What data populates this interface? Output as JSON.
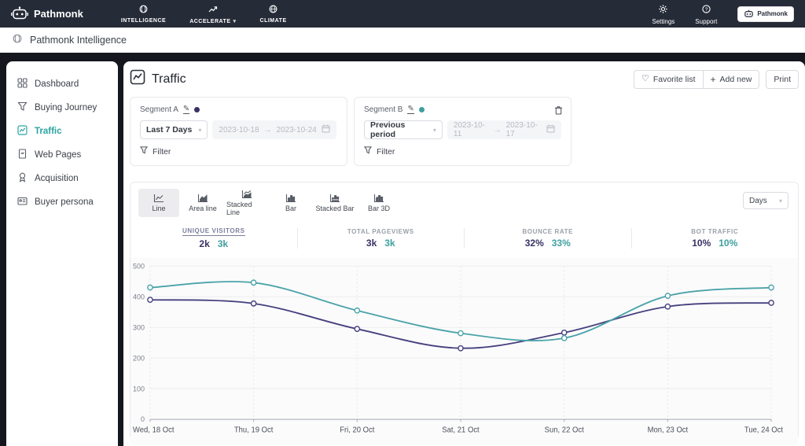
{
  "theme": {
    "navbar_bg": "#262b38",
    "page_bg": "#15171e",
    "purple": "#373264",
    "teal": "#3f9f9f",
    "active_teal": "#2ba3a1"
  },
  "navbar": {
    "brand": "Pathmonk",
    "items": [
      "INTELLIGENCE",
      "ACCELERATE",
      "CLIMATE"
    ],
    "settings": "Settings",
    "support": "Support",
    "account": "Pathmonk"
  },
  "subheader": {
    "title": "Pathmonk Intelligence"
  },
  "sidebar": {
    "items": [
      {
        "label": "Dashboard"
      },
      {
        "label": "Buying Journey"
      },
      {
        "label": "Traffic"
      },
      {
        "label": "Web Pages"
      },
      {
        "label": "Acquisition"
      },
      {
        "label": "Buyer persona"
      }
    ],
    "active_item": "Traffic"
  },
  "page": {
    "title": "Traffic",
    "favorite": "Favorite list",
    "add_new": "Add new",
    "print": "Print"
  },
  "segments": {
    "a": {
      "name": "Segment A",
      "color": "#373264",
      "range_type": "Last 7 Days",
      "date_start": "2023-10-18",
      "date_end": "2023-10-24",
      "filter": "Filter"
    },
    "b": {
      "name": "Segment B",
      "color": "#3f9f9f",
      "range_type": "Previous period",
      "date_start": "2023-10-11",
      "date_end": "2023-10-17",
      "filter": "Filter"
    }
  },
  "chart_controls": {
    "tabs": [
      {
        "label": "Line"
      },
      {
        "label": "Area line"
      },
      {
        "label": "Stacked Line"
      },
      {
        "label": "Bar"
      },
      {
        "label": "Stacked Bar"
      },
      {
        "label": "Bar 3D"
      }
    ],
    "active_tab": "Line",
    "interval": "Days"
  },
  "metrics": [
    {
      "label": "UNIQUE VISITORS",
      "a": "2k",
      "b": "3k",
      "active": true
    },
    {
      "label": "TOTAL PAGEVIEWS",
      "a": "3k",
      "b": "3k",
      "active": false
    },
    {
      "label": "BOUNCE RATE",
      "a": "32%",
      "b": "33%",
      "active": false
    },
    {
      "label": "BOT TRAFFIC",
      "a": "10%",
      "b": "10%",
      "active": false
    }
  ],
  "glyphs": {
    "edit": "✎",
    "heart": "♡",
    "plus": "+",
    "arrow": "→",
    "chevron": "▾"
  },
  "chart_data": {
    "type": "line",
    "title": "Traffic — Unique visitors per day",
    "categories": [
      "Wed, 18 Oct",
      "Thu, 19 Oct",
      "Fri, 20 Oct",
      "Sat, 21 Oct",
      "Sun, 22 Oct",
      "Mon, 23 Oct",
      "Tue, 24 Oct"
    ],
    "series": [
      {
        "name": "Segment A (Last 7 Days)",
        "color": "#46407e",
        "values": [
          390,
          378,
          295,
          232,
          283,
          368,
          380
        ]
      },
      {
        "name": "Segment B (Previous period)",
        "color": "#4ba3a8",
        "values": [
          430,
          446,
          355,
          281,
          265,
          403,
          430
        ]
      }
    ],
    "xlabel": "",
    "ylabel": "",
    "ylim": [
      0,
      500
    ],
    "yticks": [
      0,
      100,
      200,
      300,
      400,
      500
    ],
    "grid": true,
    "legend_position": "none",
    "marker": "circle-open"
  }
}
